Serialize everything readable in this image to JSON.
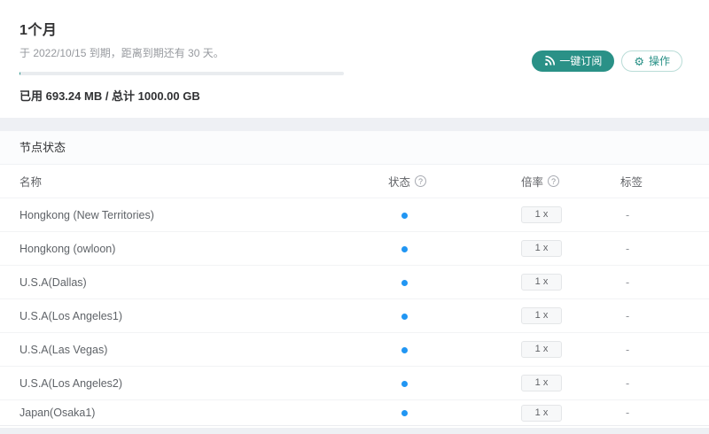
{
  "plan": {
    "title": "1个月",
    "expiry_text": "于 2022/10/15 到期，距离到期还有 30 天。",
    "usage_text": "已用 693.24 MB / 总计 1000.00 GB",
    "progress_percent": 0.07,
    "subscribe_label": "一键订阅",
    "action_label": "操作"
  },
  "icons": {
    "gear_glyph": "⚙",
    "help_glyph": "?"
  },
  "colors": {
    "accent_teal": "#2a9187",
    "status_dot_blue": "#2196f3",
    "page_background": "#eef0f4"
  },
  "nodes": {
    "section_title": "节点状态",
    "columns": {
      "name": "名称",
      "status": "状态",
      "rate": "倍率",
      "tags": "标签"
    },
    "rows": [
      {
        "name": "Hongkong (New Territories)",
        "status": "online",
        "rate": "1 x",
        "tags": "-"
      },
      {
        "name": "Hongkong (owloon)",
        "status": "online",
        "rate": "1 x",
        "tags": "-"
      },
      {
        "name": "U.S.A(Dallas)",
        "status": "online",
        "rate": "1 x",
        "tags": "-"
      },
      {
        "name": "U.S.A(Los Angeles1)",
        "status": "online",
        "rate": "1 x",
        "tags": "-"
      },
      {
        "name": "U.S.A(Las Vegas)",
        "status": "online",
        "rate": "1 x",
        "tags": "-"
      },
      {
        "name": "U.S.A(Los Angeles2)",
        "status": "online",
        "rate": "1 x",
        "tags": "-"
      },
      {
        "name": "Japan(Osaka1)",
        "status": "online",
        "rate": "1 x",
        "tags": "-"
      }
    ]
  }
}
